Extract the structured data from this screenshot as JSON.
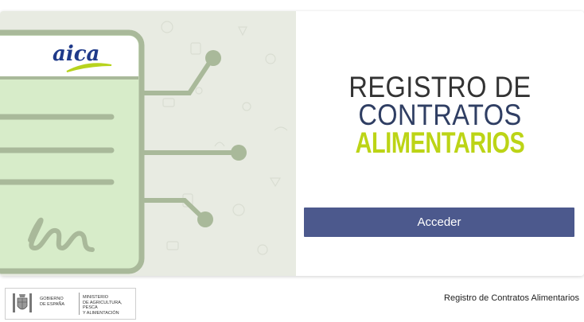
{
  "hero": {
    "brand_logo_text": "aica",
    "illustration": "document-signature-circuit-icon",
    "colors": {
      "background": "#e8ebe2",
      "frame": "#a9b99a",
      "paper": "#d7ecc9",
      "header": "#ffffff",
      "brand_text": "#1f3a8a",
      "brand_swoosh": "#b7d31e"
    }
  },
  "title": {
    "line1": "REGISTRO DE",
    "line2": "CONTRATOS",
    "line3": "ALIMENTARIOS",
    "colors": {
      "line1": "#333333",
      "line2": "#2f3e63",
      "line3": "#bcd416"
    }
  },
  "login": {
    "button_label": "Acceder",
    "button_color": "#4c598d"
  },
  "footer": {
    "gov_line": "GOBIERNO\nDE ESPAÑA",
    "ministry_line": "MINISTERIO\nDE AGRICULTURA, PESCA\nY ALIMENTACIÓN",
    "app_name": "Registro de Contratos Alimentarios"
  }
}
